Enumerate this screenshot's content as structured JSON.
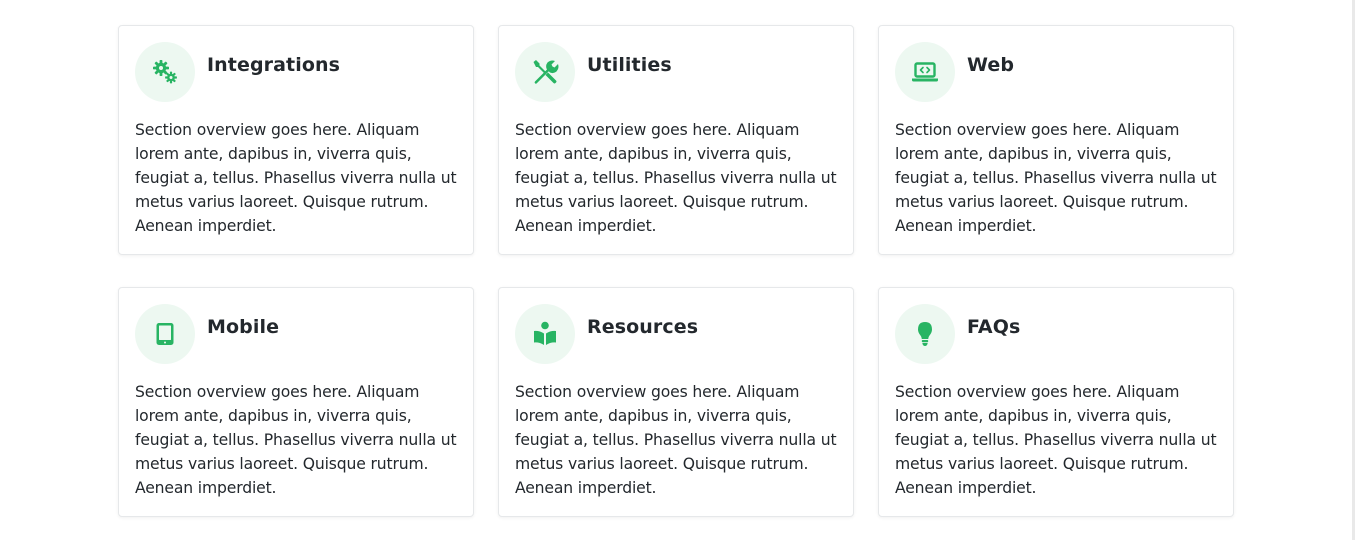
{
  "colors": {
    "accent": "#28b463",
    "icon_bg": "#edf8f1",
    "text": "#23282d",
    "card_border": "#e6e8ea"
  },
  "cards": [
    {
      "title": "Integrations",
      "icon": "cogs-icon",
      "text": "Section overview goes here. Aliquam lorem ante, dapibus in, viverra quis, feugiat a, tellus. Phasellus viverra nulla ut metus varius laoreet. Quisque rutrum. Aenean imperdiet."
    },
    {
      "title": "Utilities",
      "icon": "tools-icon",
      "text": "Section overview goes here. Aliquam lorem ante, dapibus in, viverra quis, feugiat a, tellus. Phasellus viverra nulla ut metus varius laoreet. Quisque rutrum. Aenean imperdiet."
    },
    {
      "title": "Web",
      "icon": "laptop-code-icon",
      "text": "Section overview goes here. Aliquam lorem ante, dapibus in, viverra quis, feugiat a, tellus. Phasellus viverra nulla ut metus varius laoreet. Quisque rutrum. Aenean imperdiet."
    },
    {
      "title": "Mobile",
      "icon": "tablet-icon",
      "text": "Section overview goes here. Aliquam lorem ante, dapibus in, viverra quis, feugiat a, tellus. Phasellus viverra nulla ut metus varius laoreet. Quisque rutrum. Aenean imperdiet."
    },
    {
      "title": "Resources",
      "icon": "book-reader-icon",
      "text": "Section overview goes here. Aliquam lorem ante, dapibus in, viverra quis, feugiat a, tellus. Phasellus viverra nulla ut metus varius laoreet. Quisque rutrum. Aenean imperdiet."
    },
    {
      "title": "FAQs",
      "icon": "lightbulb-icon",
      "text": "Section overview goes here. Aliquam lorem ante, dapibus in, viverra quis, feugiat a, tellus. Phasellus viverra nulla ut metus varius laoreet. Quisque rutrum. Aenean imperdiet."
    }
  ]
}
